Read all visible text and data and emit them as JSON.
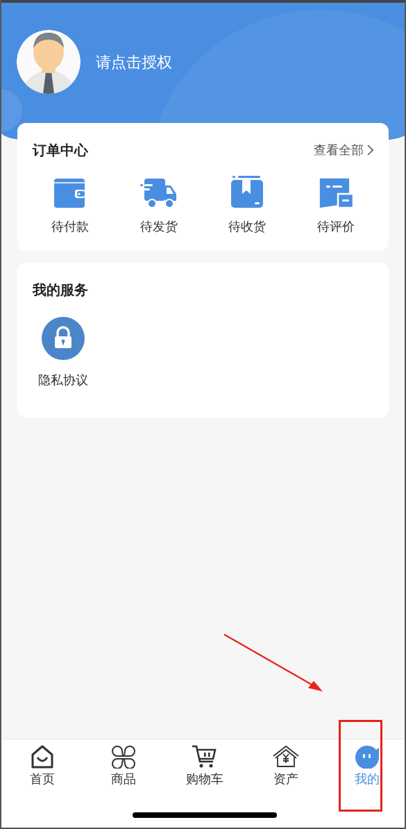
{
  "profile": {
    "prompt": "请点击授权"
  },
  "order_center": {
    "title": "订单中心",
    "view_all": "查看全部",
    "items": [
      {
        "kind": "wallet",
        "label": "待付款"
      },
      {
        "kind": "truck",
        "label": "待发货"
      },
      {
        "kind": "box",
        "label": "待收货"
      },
      {
        "kind": "chat",
        "label": "待评价"
      }
    ]
  },
  "services": {
    "title": "我的服务",
    "items": [
      {
        "kind": "lock",
        "label": "隐私协议"
      }
    ]
  },
  "tab_bar": [
    {
      "kind": "home",
      "label": "首页",
      "selected": false,
      "highlighted": false
    },
    {
      "kind": "clover",
      "label": "商品",
      "selected": false,
      "highlighted": false
    },
    {
      "kind": "cart",
      "label": "购物车",
      "selected": false,
      "highlighted": false
    },
    {
      "kind": "assets",
      "label": "资产",
      "selected": false,
      "highlighted": false
    },
    {
      "kind": "me",
      "label": "我的",
      "selected": true,
      "highlighted": true
    }
  ],
  "annotations": [
    {
      "kind": "arrow"
    }
  ]
}
